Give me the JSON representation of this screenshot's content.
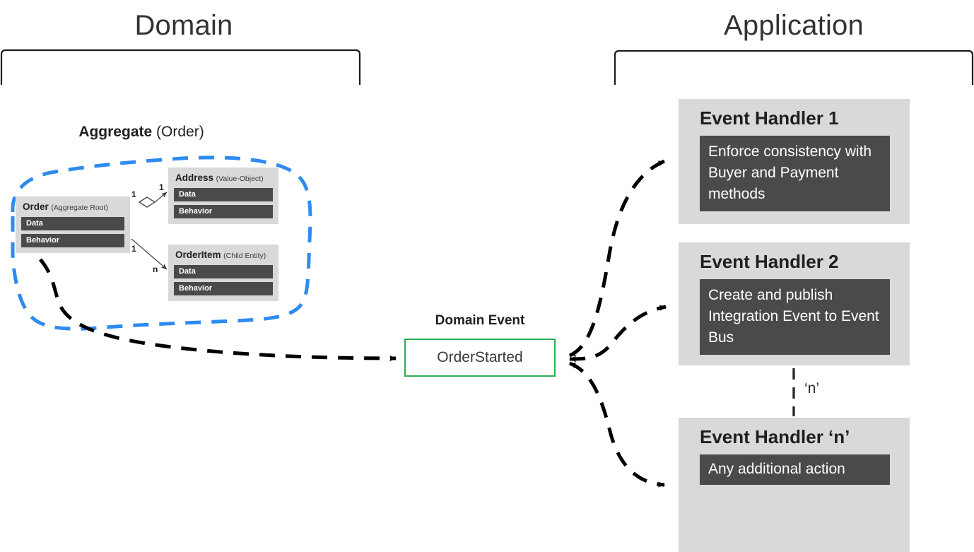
{
  "sections": {
    "domain": {
      "title": "Domain"
    },
    "application": {
      "title": "Application"
    }
  },
  "aggregate": {
    "title_bold": "Aggregate",
    "title_normal": "(Order)",
    "boundary_color": "#2e8bf0",
    "classes": [
      {
        "name": "Order",
        "stereotype": "(Aggregate Root)",
        "rows": [
          "Data",
          "Behavior"
        ]
      },
      {
        "name": "Address",
        "stereotype": "(Value-Object)",
        "rows": [
          "Data",
          "Behavior"
        ]
      },
      {
        "name": "OrderItem",
        "stereotype": "(Child Entity)",
        "rows": [
          "Data",
          "Behavior"
        ]
      }
    ],
    "multiplicities": {
      "order_to_address_source": "1",
      "order_to_address_target": "1",
      "order_to_orderitem_source": "1",
      "order_to_orderitem_target": "n"
    }
  },
  "domain_event": {
    "label": "Domain Event",
    "name": "OrderStarted",
    "border_color": "#2eab55"
  },
  "handlers": [
    {
      "title": "Event Handler 1",
      "body": "Enforce consistency with Buyer and Payment methods"
    },
    {
      "title": "Event Handler 2",
      "body": "Create and publish Integration Event to Event Bus"
    },
    {
      "title": "Event Handler ‘n’",
      "body": "Any additional action"
    }
  ],
  "connector": {
    "repeat_label": "‘n’"
  },
  "colors": {
    "card_background": "#d9d9d9",
    "row_background": "#4a4a4a",
    "aggregate_dash": "#2e8bf0",
    "event_border": "#2eab55",
    "flow_arrow": "#000000",
    "text": "#1f1f1f"
  }
}
